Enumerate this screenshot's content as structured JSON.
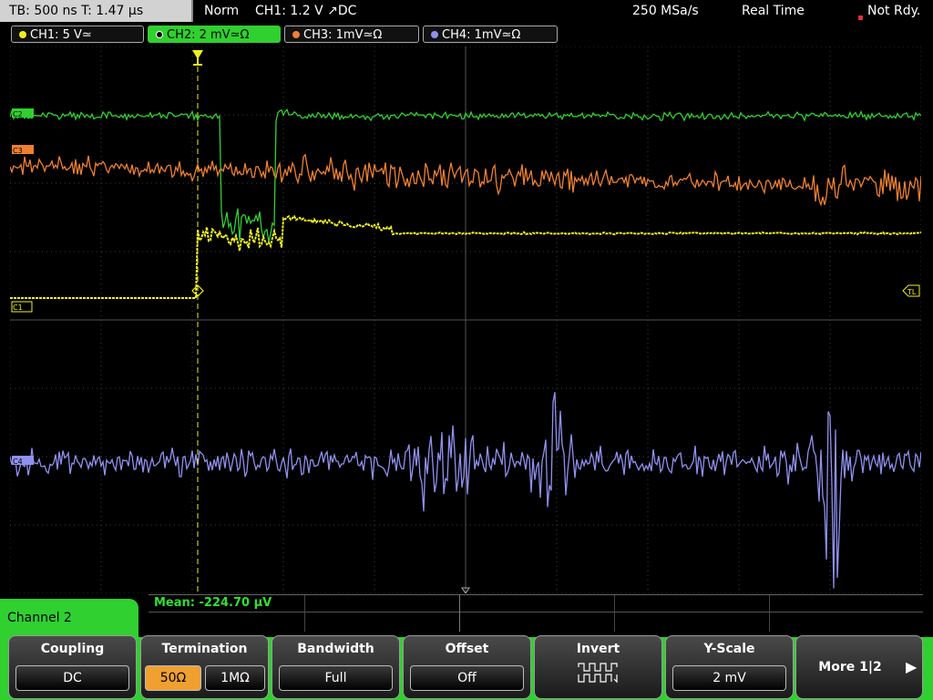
{
  "status": {
    "timebase": "TB: 500 ns   T: 1.47 µs",
    "mode": "Norm",
    "trigger": "CH1: 1.2 V ↗DC",
    "sample_rate": "250 MSa/s",
    "acq_mode": "Real Time",
    "state": "Not Rdy."
  },
  "channels": [
    {
      "label": "CH1: 5 V≃",
      "color": "#f0f020"
    },
    {
      "label": "CH2: 2 mV≃Ω",
      "color": "#30d030"
    },
    {
      "label": "CH3: 1mV≃Ω",
      "color": "#f08030"
    },
    {
      "label": "CH4: 1mV≃Ω",
      "color": "#9090f0"
    }
  ],
  "markers": {
    "c2": "C2",
    "c3": "C3",
    "c1": "C1",
    "c4": "C4",
    "tl": "TL"
  },
  "measurement": {
    "text": "Mean: -224.70 µV"
  },
  "panel": {
    "title": "Channel 2",
    "coupling": {
      "label": "Coupling",
      "value": "DC"
    },
    "termination": {
      "label": "Termination",
      "opt1": "50Ω",
      "opt2": "1MΩ"
    },
    "bandwidth": {
      "label": "Bandwidth",
      "value": "Full"
    },
    "offset": {
      "label": "Offset",
      "value": "Off"
    },
    "invert": {
      "label": "Invert"
    },
    "yscale": {
      "label": "Y-Scale",
      "value": "2 mV"
    },
    "more": {
      "label": "More 1|2"
    }
  },
  "colors": {
    "ch1": "#f0f020",
    "ch2": "#30d030",
    "ch3": "#f08030",
    "ch4": "#9090f0",
    "grid": "#3c3c3c"
  }
}
